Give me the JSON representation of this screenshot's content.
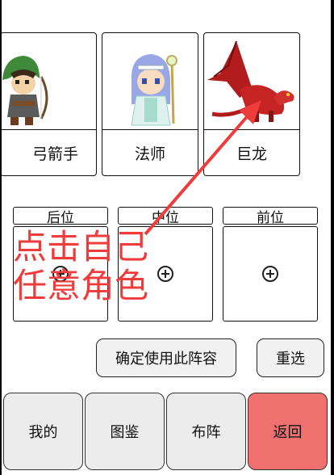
{
  "characters": [
    {
      "name": "弓箭手",
      "visible_name": "弓箭手",
      "icon": "archer-portrait"
    },
    {
      "name": "法师",
      "icon": "mage-portrait"
    },
    {
      "name": "巨龙",
      "icon": "red-dragon-portrait"
    }
  ],
  "formation": {
    "slots": [
      {
        "label": "后位",
        "icon": "add-circle-icon"
      },
      {
        "label": "中位",
        "icon": "add-circle-icon"
      },
      {
        "label": "前位",
        "icon": "add-circle-icon"
      }
    ]
  },
  "actions": {
    "confirm_label": "确定使用此阵容",
    "reset_label": "重选"
  },
  "tabs": [
    {
      "label": "我的"
    },
    {
      "label": "图鉴"
    },
    {
      "label": "布阵"
    },
    {
      "label": "返回",
      "color": "#f07070"
    }
  ],
  "annotation": {
    "line1": "点击自己",
    "line2": "任意角色",
    "color": "#ee3b3b"
  }
}
